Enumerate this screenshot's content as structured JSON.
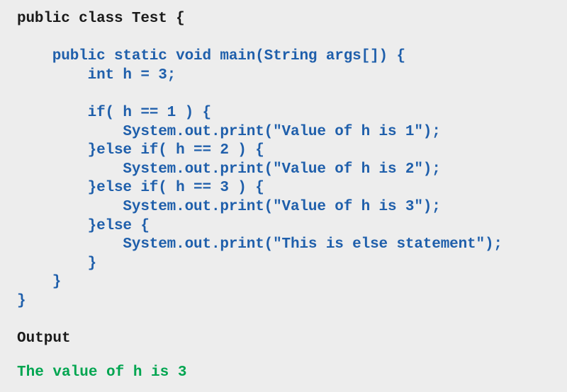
{
  "colors": {
    "background": "#ededed",
    "keyword_dark": "#1a1a1a",
    "code_blue": "#1f5fab",
    "output_green": "#00a550"
  },
  "code": {
    "language": "java",
    "lines": [
      {
        "text": "public class Test {",
        "color": "dark"
      },
      {
        "text": "",
        "color": "dark"
      },
      {
        "text": "    public static void main(String args[]) {",
        "color": "blue"
      },
      {
        "text": "        int h = 3;",
        "color": "blue"
      },
      {
        "text": "",
        "color": "blue"
      },
      {
        "text": "        if( h == 1 ) {",
        "color": "blue"
      },
      {
        "text": "            System.out.print(\"Value of h is 1\");",
        "color": "blue"
      },
      {
        "text": "        }else if( h == 2 ) {",
        "color": "blue"
      },
      {
        "text": "            System.out.print(\"Value of h is 2\");",
        "color": "blue"
      },
      {
        "text": "        }else if( h == 3 ) {",
        "color": "blue"
      },
      {
        "text": "            System.out.print(\"Value of h is 3\");",
        "color": "blue"
      },
      {
        "text": "        }else {",
        "color": "blue"
      },
      {
        "text": "            System.out.print(\"This is else statement\");",
        "color": "blue"
      },
      {
        "text": "        }",
        "color": "blue"
      },
      {
        "text": "    }",
        "color": "blue"
      },
      {
        "text": "}",
        "color": "blue"
      }
    ]
  },
  "output_section": {
    "heading": "Output",
    "value": "The value of h is 3"
  }
}
